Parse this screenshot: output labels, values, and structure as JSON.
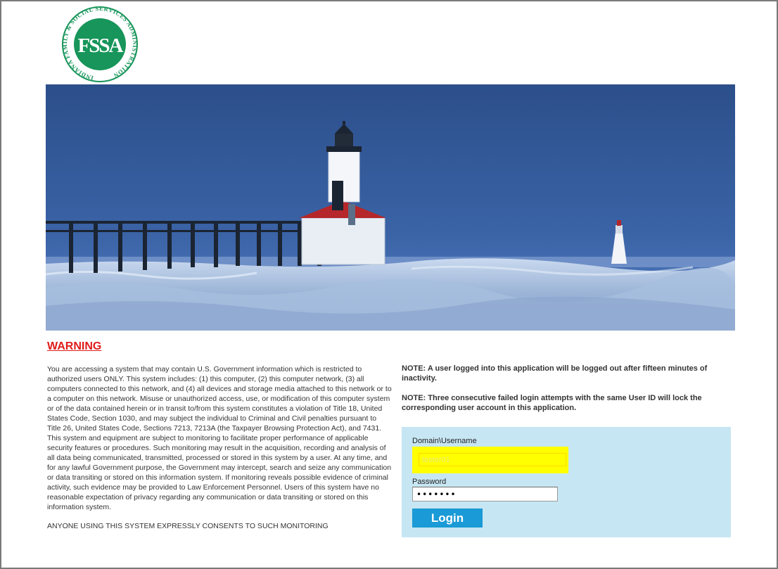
{
  "logo": {
    "monogram": "FSSA",
    "ring_text": "INDIANA FAMILY & SOCIAL SERVICES ADMINISTRATION",
    "color": "#17955a"
  },
  "warning": {
    "title": "WARNING",
    "body": "You are accessing a system that may contain U.S. Government information which is restricted to authorized users ONLY. This system includes: (1) this computer, (2) this computer network, (3) all computers connected to this network, and (4) all devices and storage media attached to this network or to a computer on this network. Misuse or unauthorized access, use, or modification of this computer system or of the data contained herein or in transit to/from this system constitutes a violation of Title 18, United States Code, Section 1030, and may subject the individual to Criminal and Civil penalties pursuant to Title 26, United States Code, Sections 7213, 7213A (the Taxpayer Browsing Protection Act), and 7431. This system and equipment are subject to monitoring to facilitate proper performance of applicable security features or procedures. Such monitoring may result in the acquisition, recording and analysis of all data being communicated, transmitted, processed or stored in this system by a user. At any time, and for any lawful Government purpose, the Government may intercept, search and seize any communication or data transiting or stored on this information system. If monitoring reveals possible evidence of criminal activity, such evidence may be provided to Law Enforcement Personnel. Users of this system have no reasonable expectation of privacy regarding any communication or data transiting or stored on this information system.",
    "consent": "ANYONE USING THIS SYSTEM EXPRESSLY CONSENTS TO SUCH MONITORING"
  },
  "notes": {
    "timeout": "NOTE: A user logged into this application will be logged out after fifteen minutes of inactivity.",
    "lockout": "NOTE: Three consecutive failed login attempts with the same User ID will lock the corresponding user account in this application."
  },
  "login": {
    "username_label": "Domain\\Username",
    "username_value": "tester01",
    "password_label": "Password",
    "password_value": "1234567",
    "button_label": "Login"
  },
  "colors": {
    "warning": "#e01b1b",
    "panel_bg": "#c7e6f3",
    "button": "#1a9ad6",
    "highlight": "#ffff00"
  }
}
